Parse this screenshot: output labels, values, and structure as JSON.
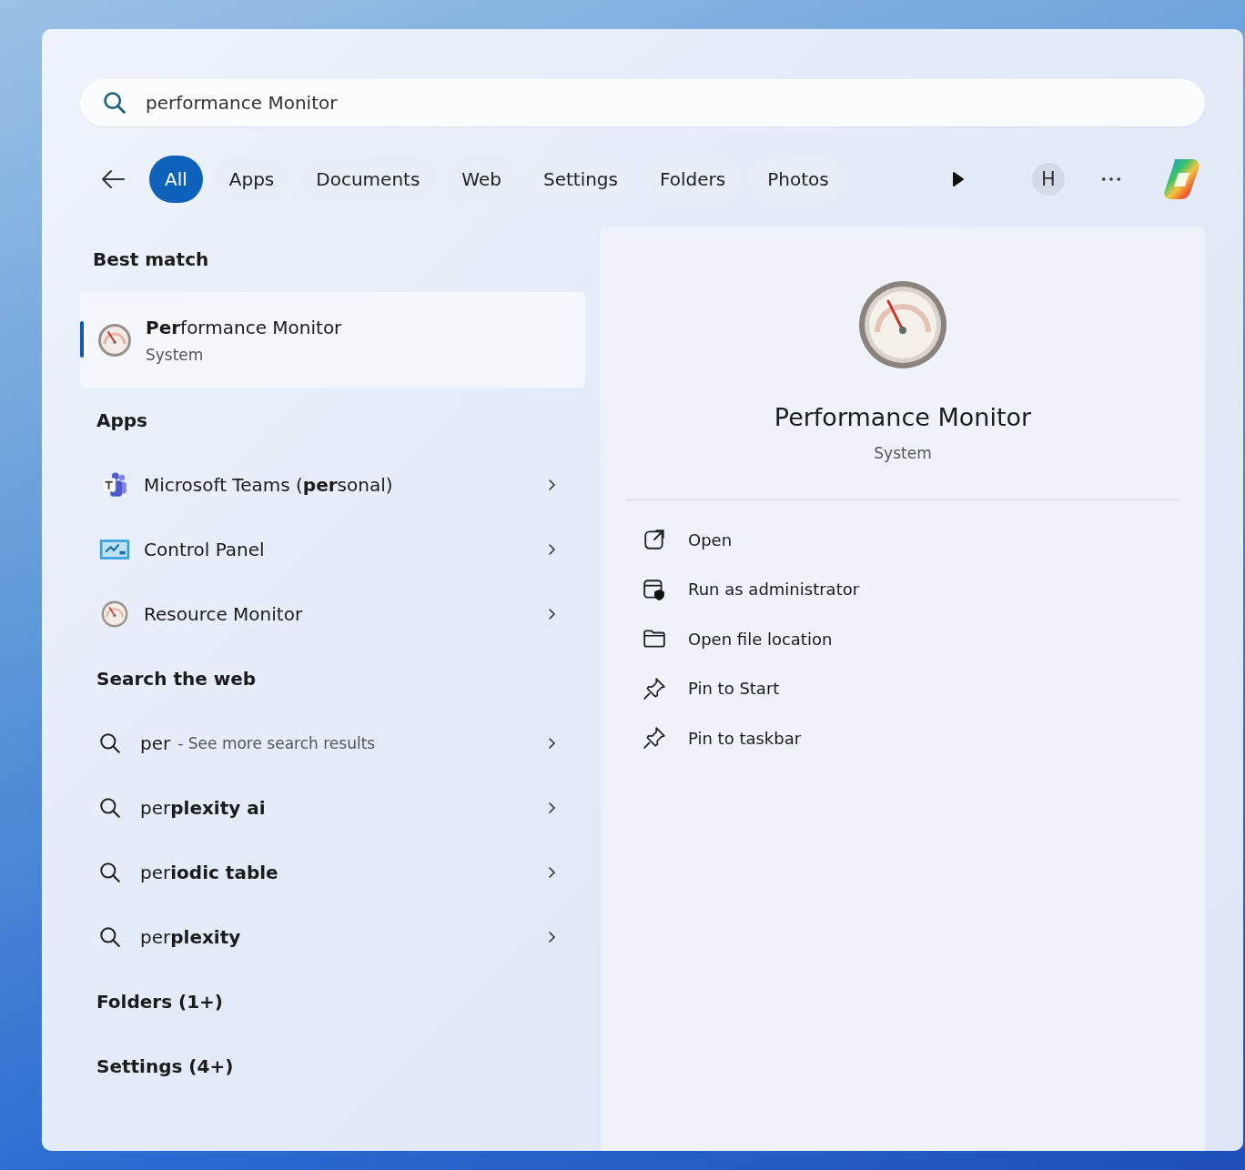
{
  "search": {
    "value": "performance Monitor"
  },
  "filters": [
    {
      "label": "All",
      "selected": true
    },
    {
      "label": "Apps",
      "selected": false
    },
    {
      "label": "Documents",
      "selected": false
    },
    {
      "label": "Web",
      "selected": false
    },
    {
      "label": "Settings",
      "selected": false
    },
    {
      "label": "Folders",
      "selected": false
    },
    {
      "label": "Photos",
      "selected": false
    }
  ],
  "account": {
    "initial": "H"
  },
  "best_match": {
    "heading": "Best match",
    "title": "**Per**formance Monitor",
    "subtitle": "System",
    "selected": true
  },
  "groups": [
    {
      "heading": "Apps",
      "items": [
        {
          "kind": "app",
          "title": "Microsoft Teams (**per**sonal)"
        },
        {
          "kind": "app",
          "title": "Control Panel"
        },
        {
          "kind": "app",
          "title": "Resource Monitor"
        }
      ]
    },
    {
      "heading": "Search the web",
      "items": [
        {
          "kind": "web",
          "title": "per",
          "suffix": "- See more search results"
        },
        {
          "kind": "web",
          "title": "per**plexity ai**"
        },
        {
          "kind": "web",
          "title": "per**iodic table**"
        },
        {
          "kind": "web",
          "title": "per**plexity**"
        }
      ]
    },
    {
      "heading": "Folders (1+)"
    },
    {
      "heading": "Settings (4+)"
    }
  ],
  "detail": {
    "title": "Performance Monitor",
    "subtitle": "System",
    "actions": [
      {
        "label": "Open"
      },
      {
        "label": "Run as administrator"
      },
      {
        "label": "Open file location"
      },
      {
        "label": "Pin to Start"
      },
      {
        "label": "Pin to taskbar"
      }
    ]
  }
}
